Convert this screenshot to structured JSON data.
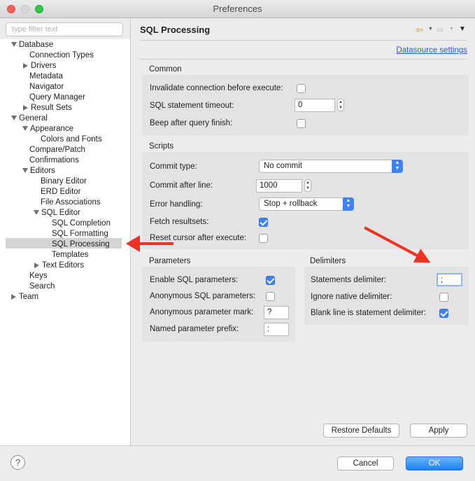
{
  "window": {
    "title": "Preferences"
  },
  "sidebar": {
    "filter_placeholder": "type filter text",
    "items": [
      {
        "label": "Database"
      },
      {
        "label": "Connection Types"
      },
      {
        "label": "Drivers"
      },
      {
        "label": "Metadata"
      },
      {
        "label": "Navigator"
      },
      {
        "label": "Query Manager"
      },
      {
        "label": "Result Sets"
      },
      {
        "label": "General"
      },
      {
        "label": "Appearance"
      },
      {
        "label": "Colors and Fonts"
      },
      {
        "label": "Compare/Patch"
      },
      {
        "label": "Confirmations"
      },
      {
        "label": "Editors"
      },
      {
        "label": "Binary Editor"
      },
      {
        "label": "ERD Editor"
      },
      {
        "label": "File Associations"
      },
      {
        "label": "SQL Editor"
      },
      {
        "label": "SQL Completion"
      },
      {
        "label": "SQL Formatting"
      },
      {
        "label": "SQL Processing"
      },
      {
        "label": "Templates"
      },
      {
        "label": "Text Editors"
      },
      {
        "label": "Keys"
      },
      {
        "label": "Search"
      },
      {
        "label": "Team"
      }
    ],
    "selected": "SQL Processing"
  },
  "main": {
    "title": "SQL Processing",
    "datasource_link": "Datasource settings",
    "common": {
      "title": "Common",
      "invalidate_label": "Invalidate connection before execute:",
      "invalidate_checked": false,
      "timeout_label": "SQL statement timeout:",
      "timeout_value": "0",
      "beep_label": "Beep after query finish:",
      "beep_checked": false
    },
    "scripts": {
      "title": "Scripts",
      "commit_type_label": "Commit type:",
      "commit_type_value": "No commit",
      "commit_after_label": "Commit after line:",
      "commit_after_value": "1000",
      "error_label": "Error handling:",
      "error_value": "Stop + rollback",
      "fetch_label": "Fetch resultsets:",
      "fetch_checked": true,
      "reset_label": "Reset cursor after execute:",
      "reset_checked": false
    },
    "parameters": {
      "title": "Parameters",
      "enable_label": "Enable SQL parameters:",
      "enable_checked": true,
      "anon_label": "Anonymous SQL parameters:",
      "anon_checked": false,
      "anon_mark_label": "Anonymous parameter mark:",
      "anon_mark_value": "?",
      "named_prefix_label": "Named parameter prefix:",
      "named_prefix_value": ":"
    },
    "delimiters": {
      "title": "Delimiters",
      "statements_label": "Statements delimiter:",
      "statements_value": ";",
      "ignore_label": "Ignore native delimiter:",
      "ignore_checked": false,
      "blank_label": "Blank line is statement delimiter:",
      "blank_checked": true
    },
    "restore_defaults_label": "Restore Defaults",
    "apply_label": "Apply"
  },
  "footer": {
    "cancel_label": "Cancel",
    "ok_label": "OK",
    "help_symbol": "?"
  },
  "colors": {
    "accent": "#3e83f0",
    "annotation_arrow": "#ee3224",
    "link": "#2b5ad2"
  }
}
